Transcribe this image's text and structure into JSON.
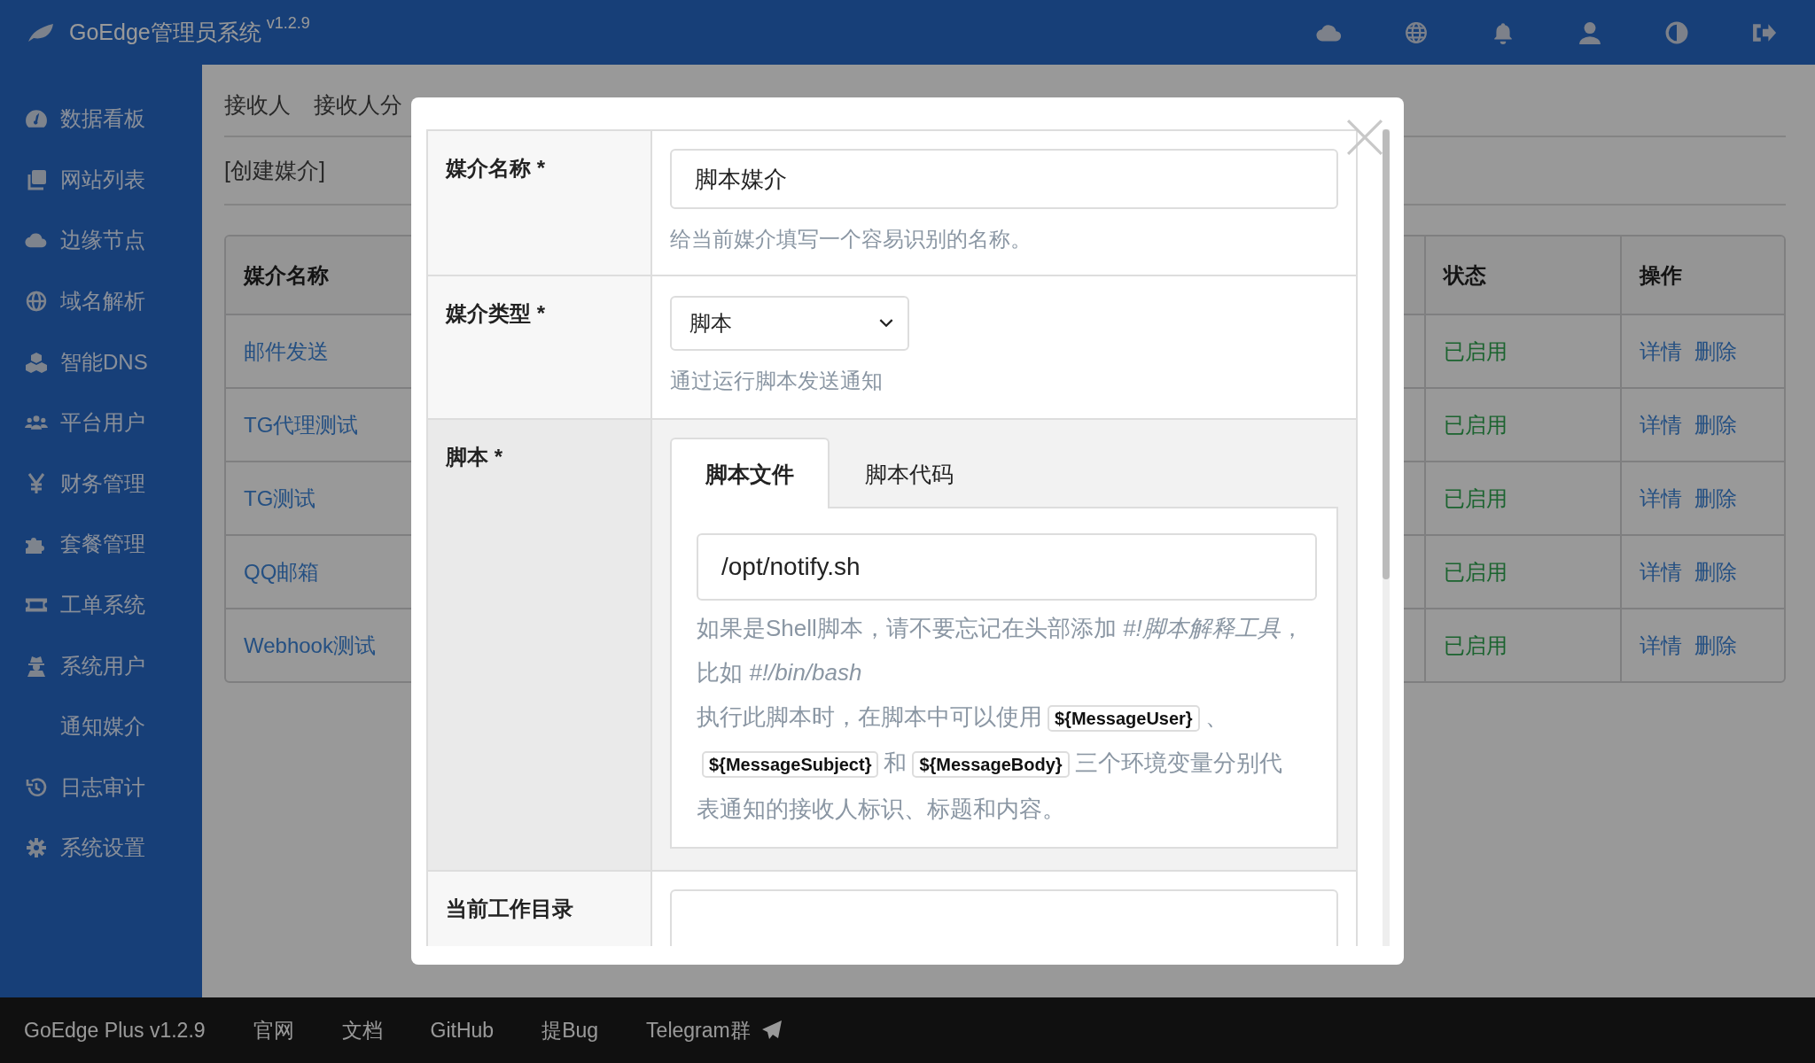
{
  "topbar": {
    "title": "GoEdge管理员系统",
    "version": "v1.2.9"
  },
  "sidebar": {
    "items": [
      {
        "label": "数据看板"
      },
      {
        "label": "网站列表"
      },
      {
        "label": "边缘节点"
      },
      {
        "label": "域名解析"
      },
      {
        "label": "智能DNS"
      },
      {
        "label": "平台用户"
      },
      {
        "label": "财务管理"
      },
      {
        "label": "套餐管理"
      },
      {
        "label": "工单系统"
      },
      {
        "label": "系统用户"
      },
      {
        "label": "通知媒介"
      },
      {
        "label": "日志审计"
      },
      {
        "label": "系统设置"
      }
    ]
  },
  "content": {
    "tabs": [
      "接收人",
      "接收人分"
    ],
    "create_link": "[创建媒介]",
    "table": {
      "columns": [
        "媒介名称",
        "状态",
        "操作"
      ],
      "rows": [
        {
          "name": "邮件发送",
          "status": "已启用",
          "actions": [
            "详情",
            "删除"
          ]
        },
        {
          "name": "TG代理测试",
          "status": "已启用",
          "actions": [
            "详情",
            "删除"
          ]
        },
        {
          "name": "TG测试",
          "status": "已启用",
          "actions": [
            "详情",
            "删除"
          ]
        },
        {
          "name": "QQ邮箱",
          "status": "已启用",
          "actions": [
            "详情",
            "删除"
          ]
        },
        {
          "name": "Webhook测试",
          "status": "已启用",
          "actions": [
            "详情",
            "删除"
          ]
        }
      ]
    }
  },
  "dialog": {
    "fields": [
      {
        "kind": "text",
        "label": "媒介名称 *",
        "value": "脚本媒介",
        "help": "给当前媒介填写一个容易识别的名称。"
      },
      {
        "kind": "select",
        "label": "媒介类型 *",
        "value": "脚本",
        "help": "通过运行脚本发送通知"
      },
      {
        "kind": "script",
        "label": "脚本 *",
        "tabs": [
          {
            "label": "脚本文件",
            "selected": true
          },
          {
            "label": "脚本代码",
            "selected": false
          }
        ],
        "value": "/opt/notify.sh",
        "help": [
          [
            {
              "kind": "text",
              "text": "如果是Shell脚本，请不要忘记在头部添加 *#!脚本解释工具*，比如 *#!/bin/bash*"
            }
          ],
          [
            {
              "kind": "text",
              "text": "执行此脚本时，在脚本中可以使用"
            },
            {
              "kind": "code",
              "text": "${MessageUser}"
            },
            {
              "kind": "text",
              "text": "、"
            },
            {
              "kind": "code",
              "text": "${MessageSubject}"
            },
            {
              "kind": "text",
              "text": "和"
            },
            {
              "kind": "code",
              "text": "${MessageBody}"
            },
            {
              "kind": "text",
              "text": "三个环境变量分别代"
            },
            {
              "kind": "line",
              "text": "表通知的接收人标识、标题和内容。"
            }
          ]
        ]
      },
      {
        "kind": "text",
        "label": "当前工作目录"
      }
    ]
  },
  "footer": {
    "brand": "GoEdge Plus v1.2.9",
    "links": [
      "官网",
      "文档",
      "GitHub",
      "提Bug",
      "Telegram群"
    ]
  }
}
